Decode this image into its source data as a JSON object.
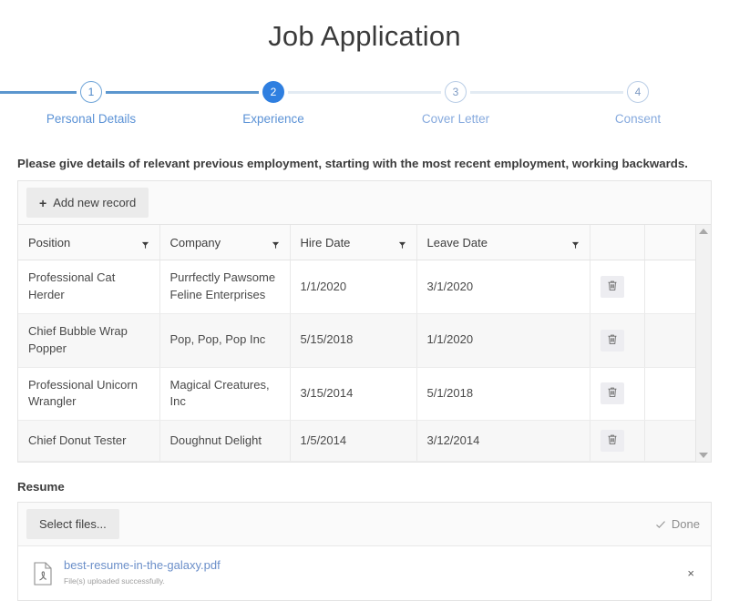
{
  "page": {
    "title": "Job Application"
  },
  "stepper": {
    "steps": [
      {
        "number": "1",
        "label": "Personal Details",
        "state": "done"
      },
      {
        "number": "2",
        "label": "Experience",
        "state": "active"
      },
      {
        "number": "3",
        "label": "Cover Letter",
        "state": "pending"
      },
      {
        "number": "4",
        "label": "Consent",
        "state": "pending"
      }
    ],
    "colors": {
      "active_fill": "#2f7fe0",
      "done_border": "#6ea4d8",
      "pending_border": "#b9cde6",
      "line_done": "#5b96ce",
      "line_pending": "#e3ebf3",
      "label": "#5b92d6"
    }
  },
  "experience": {
    "instruction": "Please give details of relevant previous employment, starting with the most recent employment, working backwards.",
    "toolbar": {
      "add_label": "Add new record",
      "add_plus": "+"
    },
    "columns": [
      {
        "label": "Position",
        "filter_icon": "filter-icon"
      },
      {
        "label": "Company",
        "filter_icon": "filter-icon"
      },
      {
        "label": "Hire Date",
        "filter_icon": "filter-icon"
      },
      {
        "label": "Leave Date",
        "filter_icon": "filter-icon"
      }
    ],
    "rows": [
      {
        "position": "Professional Cat Herder",
        "company": "Purrfectly Pawsome Feline Enterprises",
        "hire_date": "1/1/2020",
        "leave_date": "3/1/2020",
        "delete_icon": "trash-icon"
      },
      {
        "position": "Chief Bubble Wrap Popper",
        "company": "Pop, Pop, Pop Inc",
        "hire_date": "5/15/2018",
        "leave_date": "1/1/2020",
        "delete_icon": "trash-icon"
      },
      {
        "position": "Professional Unicorn Wrangler",
        "company": "Magical Creatures, Inc",
        "hire_date": "3/15/2014",
        "leave_date": "5/1/2018",
        "delete_icon": "trash-icon"
      },
      {
        "position": "Chief Donut Tester",
        "company": "Doughnut Delight",
        "hire_date": "1/5/2014",
        "leave_date": "3/12/2014",
        "delete_icon": "trash-icon"
      }
    ]
  },
  "resume": {
    "label": "Resume",
    "select_files_label": "Select files...",
    "status_text": "Done",
    "status_icon": "check-icon",
    "file": {
      "icon": "pdf-file-icon",
      "name": "best-resume-in-the-galaxy.pdf",
      "caption": "File(s) uploaded successfully.",
      "remove_label": "×"
    }
  }
}
